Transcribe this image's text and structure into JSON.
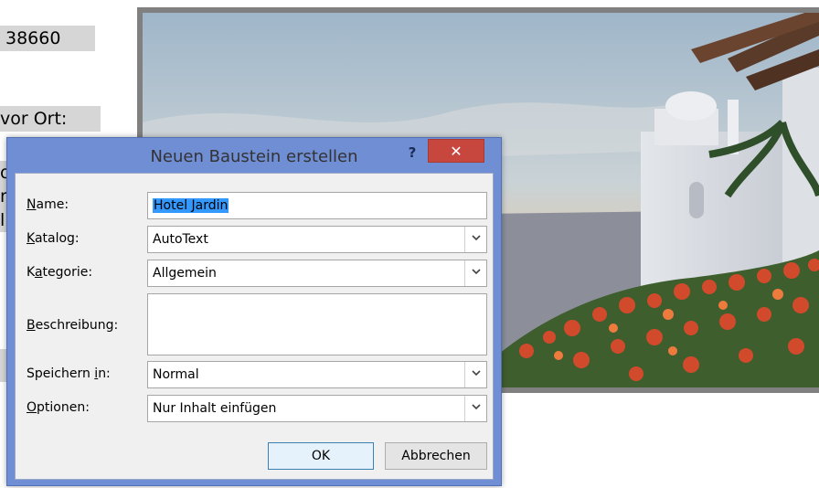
{
  "document": {
    "zip_fragment": "38660",
    "vor_ort_fragment": "vor Ort:",
    "clipped_lines": [
      "o",
      "n",
      "l"
    ]
  },
  "dialog": {
    "title": "Neuen Baustein erstellen",
    "help_glyph": "?",
    "close_glyph": "✕",
    "fields": {
      "name": {
        "label": "Name:",
        "access_key_index": 0,
        "value": "Hotel Jardin"
      },
      "katalog": {
        "label": "Katalog:",
        "access_key_index": 0,
        "value": "AutoText"
      },
      "kategorie": {
        "label": "Kategorie:",
        "access_key_index": 1,
        "value": "Allgemein"
      },
      "beschreibung": {
        "label": "Beschreibung:",
        "access_key_index": 0,
        "value": ""
      },
      "speichern_in": {
        "label": "Speichern in:",
        "access_key_index": 10,
        "value": "Normal"
      },
      "optionen": {
        "label": "Optionen:",
        "access_key_index": 0,
        "value": "Nur Inhalt einfügen"
      }
    },
    "buttons": {
      "ok": "OK",
      "cancel": "Abbrechen"
    },
    "icons": {
      "dropdown": "chevron-down-icon",
      "close": "close-icon",
      "help": "help-icon"
    }
  },
  "colors": {
    "title_bar": "#6f8ed4",
    "close_button": "#c7473e",
    "selection": "#3399ff",
    "client_background": "#f0f0f0",
    "document_highlight": "#d6d6d6"
  }
}
